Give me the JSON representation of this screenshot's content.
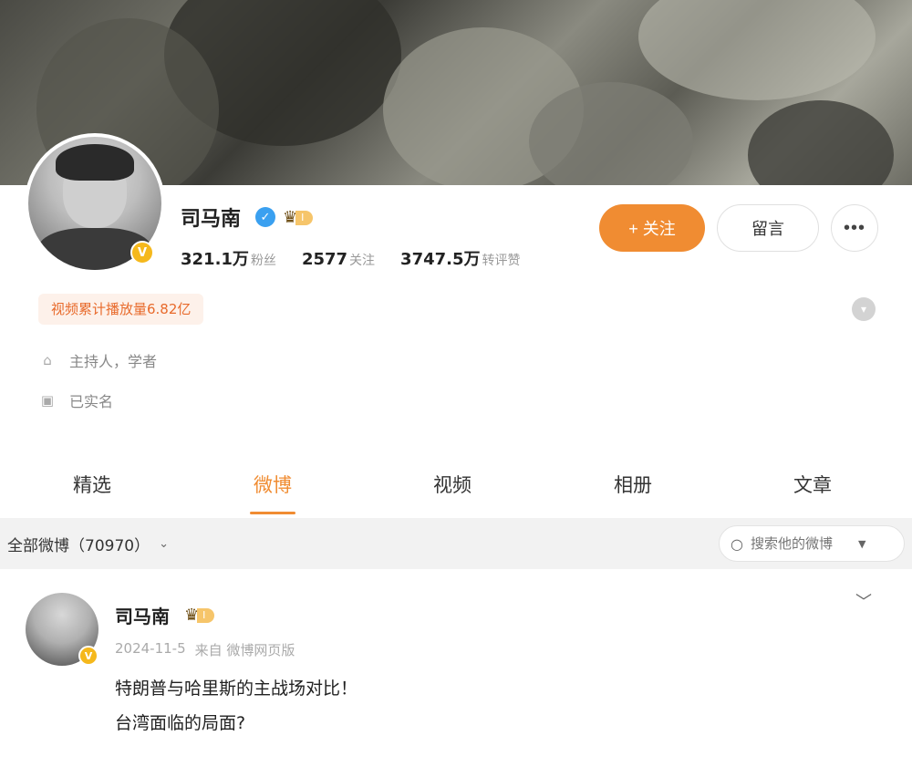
{
  "profile": {
    "name": "司马南",
    "level": "I",
    "stats": [
      {
        "value": "321.1万",
        "label": "粉丝"
      },
      {
        "value": "2577",
        "label": "关注"
      },
      {
        "value": "3747.5万",
        "label": "转评赞"
      }
    ],
    "follow_label": "+ 关注",
    "message_label": "留言",
    "more_label": "•••",
    "play_badge": "视频累计播放量6.82亿",
    "info": [
      {
        "icon": "tag-icon",
        "text": "主持人，学者"
      },
      {
        "icon": "id-card-icon",
        "text": "已实名"
      }
    ]
  },
  "tabs": [
    {
      "label": "精选",
      "active": false
    },
    {
      "label": "微博",
      "active": true
    },
    {
      "label": "视频",
      "active": false
    },
    {
      "label": "相册",
      "active": false
    },
    {
      "label": "文章",
      "active": false
    }
  ],
  "filter": {
    "label": "全部微博（70970）",
    "search_placeholder": "搜索他的微博"
  },
  "post": {
    "author": "司马南",
    "level": "I",
    "date": "2024-11-5",
    "source": "来自 微博网页版",
    "lines": [
      "特朗普与哈里斯的主战场对比！",
      "台湾面临的局面?"
    ]
  },
  "colors": {
    "accent": "#f08c32",
    "verify": "#3aa0f0",
    "badge_gold": "#f5b81c"
  }
}
